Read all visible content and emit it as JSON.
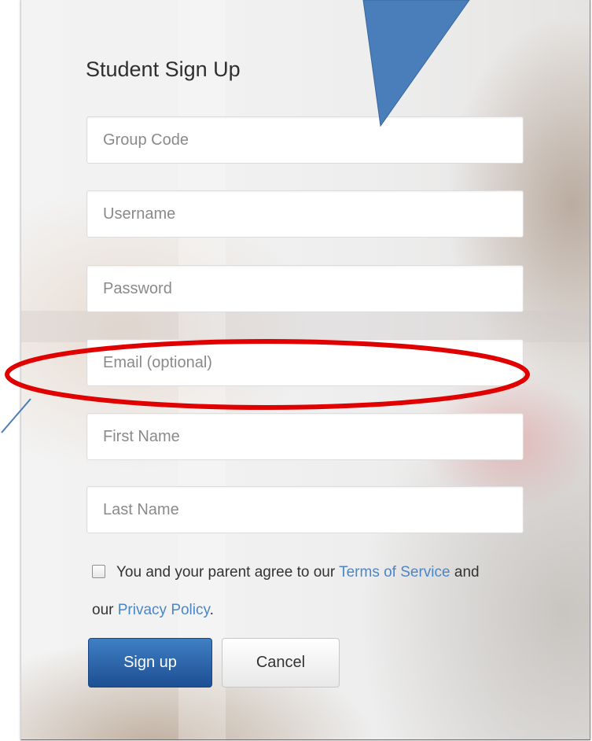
{
  "signup_form": {
    "title": "Student Sign Up",
    "fields": {
      "group_code": {
        "placeholder": "Group Code"
      },
      "username": {
        "placeholder": "Username"
      },
      "password": {
        "placeholder": "Password"
      },
      "email": {
        "placeholder": "Email (optional)"
      },
      "first_name": {
        "placeholder": "First Name"
      },
      "last_name": {
        "placeholder": "Last Name"
      }
    },
    "agreement": {
      "prefix": "You and your parent agree to our ",
      "terms_link": "Terms of Service",
      "middle": " and our ",
      "privacy_link": "Privacy Policy",
      "suffix": ".",
      "checked": false
    },
    "buttons": {
      "sign_up": "Sign up",
      "cancel": "Cancel"
    }
  },
  "annotations": {
    "callout_color": "#4a7ebb",
    "highlight_color": "#e00000",
    "icons": [
      "callout-arrow-icon",
      "highlight-ellipse-icon",
      "checkbox-icon"
    ]
  }
}
